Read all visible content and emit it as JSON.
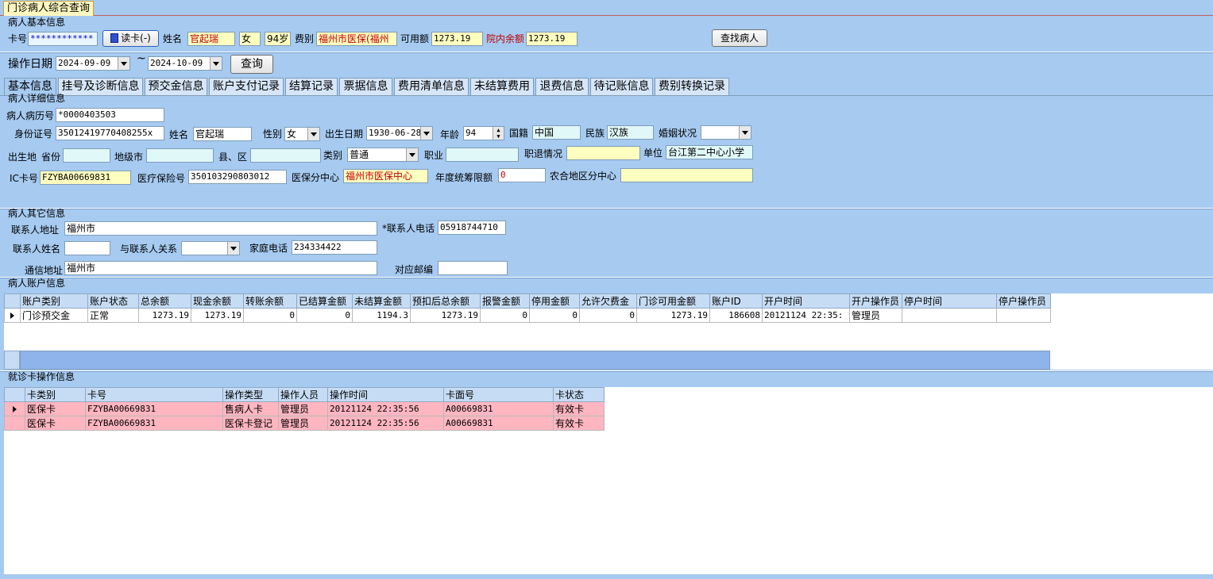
{
  "window": {
    "tab_title": "门诊病人综合查询"
  },
  "basic": {
    "section_title": "病人基本信息",
    "card_no_label": "卡号",
    "card_no_value": "************",
    "read_card_label": "读卡(-)",
    "name_label": "姓名",
    "name_value": "官起瑞",
    "sex_value": "女",
    "age_value": "94岁",
    "fee_type_label": "费别",
    "fee_type_value": "福州市医保(福州",
    "available_label": "可用额",
    "available_value": "1273.19",
    "balance_label": "院内余额",
    "balance_value": "1273.19",
    "find_button": "查找病人"
  },
  "date_query": {
    "label": "操作日期",
    "from": "2024-09-09",
    "sep": "~",
    "to": "2024-10-09",
    "query_button": "查询"
  },
  "tabs": [
    "基本信息",
    "挂号及诊断信息",
    "预交金信息",
    "账户支付记录",
    "结算记录",
    "票据信息",
    "费用清单信息",
    "未结算费用",
    "退费信息",
    "待记账信息",
    "费别转换记录"
  ],
  "detail": {
    "section_title": "病人详细信息",
    "record_no_label": "病人病历号",
    "record_no_value": "*0000403503",
    "id_label": "身份证号",
    "id_value": "35012419770408255x",
    "name_label": "姓名",
    "name_value": "官起瑞",
    "sex_label": "性别",
    "sex_value": "女",
    "birth_label": "出生日期",
    "birth_value": "1930-06-28",
    "age_label": "年龄",
    "age_value": "94",
    "nationality_label": "国籍",
    "nationality_value": "中国",
    "ethnic_label": "民族",
    "ethnic_value": "汉族",
    "marital_label": "婚姻状况",
    "marital_value": "",
    "birthplace_label": "出生地",
    "province_label": "省份",
    "city_label": "地级市",
    "county_label": "县、区",
    "category_label": "类别",
    "category_value": "普通",
    "job_label": "职业",
    "retire_label": "职退情况",
    "unit_label": "单位",
    "unit_value": "台江第二中心小学",
    "ic_label": "IC卡号",
    "ic_value": "FZYBA00669831",
    "insurance_label": "医疗保险号",
    "insurance_value": "350103290803012",
    "center_label": "医保分中心",
    "center_value": "福州市医保中心",
    "quota_label": "年度统筹限额",
    "quota_value": "0",
    "rural_label": "农合地区分中心"
  },
  "other": {
    "section_title": "病人其它信息",
    "contact_addr_label": "联系人地址",
    "contact_addr_value": "福州市",
    "contact_phone_label": "*联系人电话",
    "contact_phone_value": "05918744710",
    "contact_name_label": "联系人姓名",
    "relation_label": "与联系人关系",
    "home_phone_label": "家庭电话",
    "home_phone_value": "234334422",
    "mail_addr_label": "通信地址",
    "mail_addr_value": "福州市",
    "postcode_label": "对应邮编"
  },
  "account": {
    "section_title": "病人账户信息",
    "columns": [
      "账户类别",
      "账户状态",
      "总余额",
      "现金余额",
      "转账余额",
      "已结算金额",
      "未结算金额",
      "预扣后总余额",
      "报警金额",
      "停用金额",
      "允许欠费金",
      "门诊可用金额",
      "账户ID",
      "开户时间",
      "开户操作员",
      "停户时间",
      "停户操作员"
    ],
    "rows": [
      [
        "门诊预交金",
        "正常",
        "1273.19",
        "1273.19",
        "0",
        "0",
        "1194.3",
        "1273.19",
        "0",
        "0",
        "0",
        "1273.19",
        "186608",
        "20121124 22:35:",
        "管理员",
        "",
        ""
      ]
    ]
  },
  "card_ops": {
    "section_title": "就诊卡操作信息",
    "columns": [
      "卡类别",
      "卡号",
      "操作类型",
      "操作人员",
      "操作时间",
      "卡面号",
      "卡状态"
    ],
    "rows": [
      [
        "医保卡",
        "FZYBA00669831",
        "售病人卡",
        "管理员",
        "20121124 22:35:56",
        "A00669831",
        "有效卡"
      ],
      [
        "医保卡",
        "FZYBA00669831",
        "医保卡登记",
        "管理员",
        "20121124 22:35:56",
        "A00669831",
        "有效卡"
      ]
    ]
  }
}
